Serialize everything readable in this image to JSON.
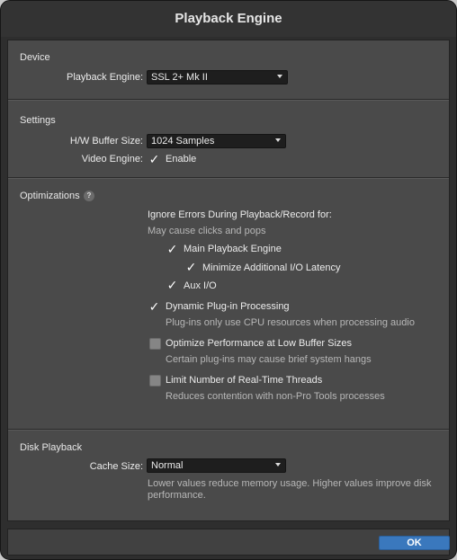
{
  "window": {
    "title": "Playback Engine"
  },
  "device": {
    "section_title": "Device",
    "playback_engine_label": "Playback Engine:",
    "playback_engine_value": "SSL 2+ Mk II"
  },
  "settings": {
    "section_title": "Settings",
    "buffer_label": "H/W Buffer Size:",
    "buffer_value": "1024 Samples",
    "video_label": "Video Engine:",
    "video_enable_label": "Enable",
    "video_enable_checked": true
  },
  "optimizations": {
    "section_title": "Optimizations",
    "help_glyph": "?",
    "ignore_errors_title": "Ignore Errors During Playback/Record for:",
    "ignore_errors_hint": "May cause clicks and pops",
    "main_playback_label": "Main Playback Engine",
    "main_playback_checked": true,
    "minimize_latency_label": "Minimize Additional I/O Latency",
    "minimize_latency_checked": true,
    "aux_io_label": "Aux I/O",
    "aux_io_checked": true,
    "dynamic_plugin_label": "Dynamic Plug-in Processing",
    "dynamic_plugin_checked": true,
    "dynamic_plugin_hint": "Plug-ins only use CPU resources when processing audio",
    "optimize_low_buffer_label": "Optimize Performance at Low Buffer Sizes",
    "optimize_low_buffer_checked": false,
    "optimize_low_buffer_hint": "Certain plug-ins may cause brief system hangs",
    "limit_threads_label": "Limit Number of Real-Time Threads",
    "limit_threads_checked": false,
    "limit_threads_hint": "Reduces contention with non-Pro Tools processes"
  },
  "disk_playback": {
    "section_title": "Disk Playback",
    "cache_label": "Cache Size:",
    "cache_value": "Normal",
    "cache_hint": "Lower values reduce memory usage. Higher values improve disk performance."
  },
  "footer": {
    "ok_label": "OK"
  },
  "colors": {
    "accent_button": "#3a78bd",
    "panel": "#4a4a4a",
    "window_frame": "#2e2e2e"
  },
  "icons": {
    "check": "checkmark-icon",
    "dropdown": "chevron-down-icon",
    "help": "help-icon"
  }
}
